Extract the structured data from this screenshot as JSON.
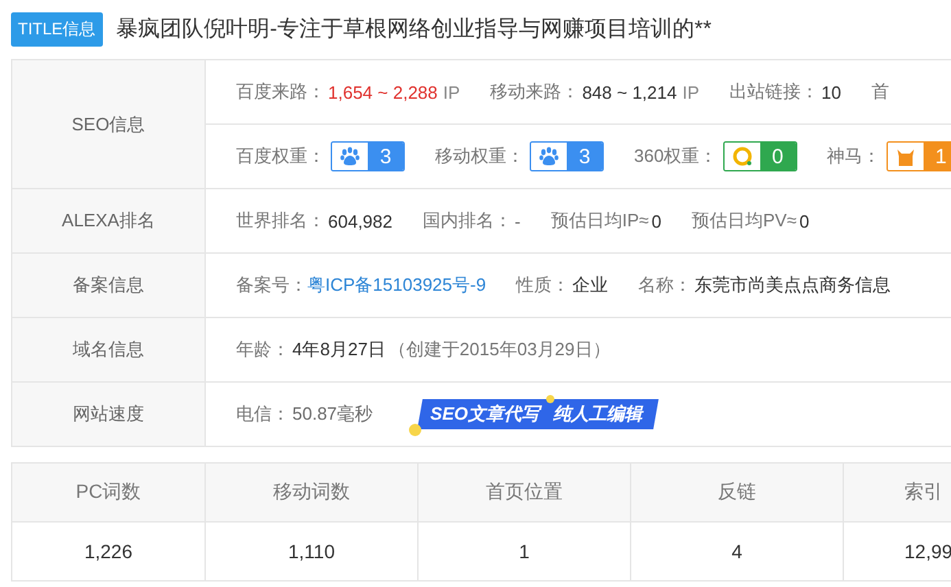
{
  "title": {
    "badge": "TITLE信息",
    "text": "暴疯团队倪叶明-专注于草根网络创业指导与网赚项目培训的**"
  },
  "info_rows": [
    {
      "label": "SEO信息",
      "lines": [
        [
          {
            "kind": "text",
            "label": "百度来路：",
            "value": "1,654 ~ 2,288",
            "unit": "IP",
            "highlight": true,
            "dim": false
          },
          {
            "kind": "text",
            "label": "移动来路：",
            "value": "848 ~ 1,214",
            "unit": "IP",
            "highlight": false,
            "dim": false
          },
          {
            "kind": "text",
            "label": "出站链接：",
            "value": "10",
            "highlight": false,
            "dim": false
          },
          {
            "kind": "text",
            "label": "首"
          }
        ],
        [
          {
            "kind": "badge",
            "label": "百度权重：",
            "value": "3",
            "color": "#3b8ff0"
          },
          {
            "kind": "badge",
            "label": "移动权重：",
            "value": "3",
            "color": "#3b8ff0"
          },
          {
            "kind": "badge",
            "label": "360权重：",
            "value": "0",
            "color": "#2fa84f"
          },
          {
            "kind": "badge",
            "label": "神马：",
            "value": "1",
            "color": "#f3901d"
          }
        ]
      ]
    },
    {
      "label": "ALEXA排名",
      "lines": [
        [
          {
            "kind": "text",
            "label": "世界排名：",
            "value": "604,982",
            "highlight": false,
            "dim": false
          },
          {
            "kind": "text",
            "label": "国内排名：",
            "value": "-",
            "highlight": false,
            "dim": true
          },
          {
            "kind": "text",
            "label": "预估日均IP≈",
            "value": "0",
            "highlight": false,
            "dim": false
          },
          {
            "kind": "text",
            "label": "预估日均PV≈",
            "value": "0",
            "highlight": false,
            "dim": false
          }
        ]
      ]
    },
    {
      "label": "备案信息",
      "lines": [
        [
          {
            "kind": "link",
            "label": "备案号：",
            "value": "粤ICP备15103925号-9"
          },
          {
            "kind": "text",
            "label": "性质：",
            "value": "企业",
            "highlight": false,
            "dim": false
          },
          {
            "kind": "text",
            "label": "名称：",
            "value": "东莞市尚美点点商务信息",
            "highlight": false,
            "dim": false
          }
        ]
      ]
    },
    {
      "label": "域名信息",
      "lines": [
        [
          {
            "kind": "text",
            "label": "年龄：",
            "value": "4年8月27日",
            "note": "（创建于2015年03月29日）",
            "highlight": false,
            "dim": false
          }
        ]
      ]
    },
    {
      "label": "网站速度",
      "lines": [
        [
          {
            "kind": "text",
            "label": "电信：",
            "value": "50.87毫秒",
            "highlight": false,
            "dim": true
          },
          {
            "kind": "banner",
            "parts": [
              "SEO文章代写",
              "纯人工编辑"
            ]
          }
        ]
      ]
    }
  ],
  "stats": {
    "columns": [
      "PC词数",
      "移动词数",
      "首页位置",
      "反链",
      "索引"
    ],
    "row": [
      "1,226",
      "1,110",
      "1",
      "4",
      "12,99"
    ]
  }
}
